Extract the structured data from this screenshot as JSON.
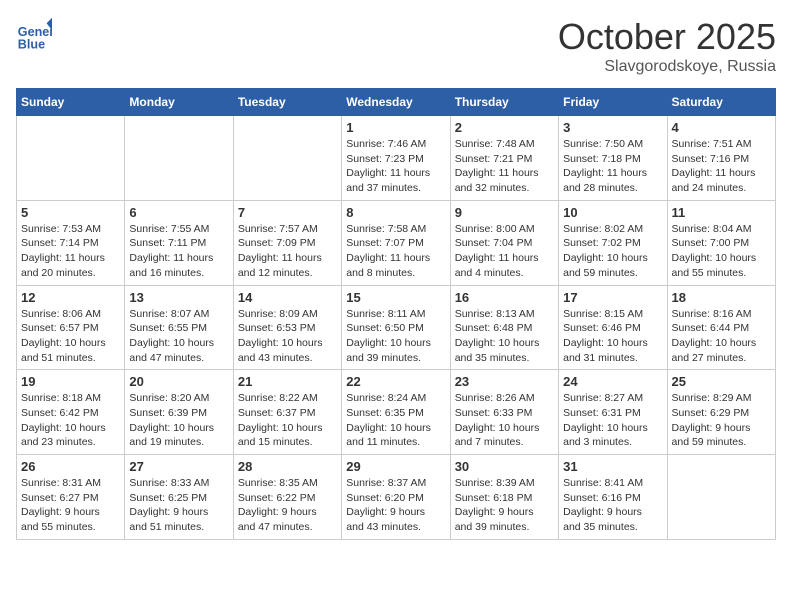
{
  "header": {
    "logo_line1": "General",
    "logo_line2": "Blue",
    "month": "October 2025",
    "location": "Slavgorodskoye, Russia"
  },
  "days_of_week": [
    "Sunday",
    "Monday",
    "Tuesday",
    "Wednesday",
    "Thursday",
    "Friday",
    "Saturday"
  ],
  "weeks": [
    [
      {
        "day": "",
        "info": ""
      },
      {
        "day": "",
        "info": ""
      },
      {
        "day": "",
        "info": ""
      },
      {
        "day": "1",
        "info": "Sunrise: 7:46 AM\nSunset: 7:23 PM\nDaylight: 11 hours\nand 37 minutes."
      },
      {
        "day": "2",
        "info": "Sunrise: 7:48 AM\nSunset: 7:21 PM\nDaylight: 11 hours\nand 32 minutes."
      },
      {
        "day": "3",
        "info": "Sunrise: 7:50 AM\nSunset: 7:18 PM\nDaylight: 11 hours\nand 28 minutes."
      },
      {
        "day": "4",
        "info": "Sunrise: 7:51 AM\nSunset: 7:16 PM\nDaylight: 11 hours\nand 24 minutes."
      }
    ],
    [
      {
        "day": "5",
        "info": "Sunrise: 7:53 AM\nSunset: 7:14 PM\nDaylight: 11 hours\nand 20 minutes."
      },
      {
        "day": "6",
        "info": "Sunrise: 7:55 AM\nSunset: 7:11 PM\nDaylight: 11 hours\nand 16 minutes."
      },
      {
        "day": "7",
        "info": "Sunrise: 7:57 AM\nSunset: 7:09 PM\nDaylight: 11 hours\nand 12 minutes."
      },
      {
        "day": "8",
        "info": "Sunrise: 7:58 AM\nSunset: 7:07 PM\nDaylight: 11 hours\nand 8 minutes."
      },
      {
        "day": "9",
        "info": "Sunrise: 8:00 AM\nSunset: 7:04 PM\nDaylight: 11 hours\nand 4 minutes."
      },
      {
        "day": "10",
        "info": "Sunrise: 8:02 AM\nSunset: 7:02 PM\nDaylight: 10 hours\nand 59 minutes."
      },
      {
        "day": "11",
        "info": "Sunrise: 8:04 AM\nSunset: 7:00 PM\nDaylight: 10 hours\nand 55 minutes."
      }
    ],
    [
      {
        "day": "12",
        "info": "Sunrise: 8:06 AM\nSunset: 6:57 PM\nDaylight: 10 hours\nand 51 minutes."
      },
      {
        "day": "13",
        "info": "Sunrise: 8:07 AM\nSunset: 6:55 PM\nDaylight: 10 hours\nand 47 minutes."
      },
      {
        "day": "14",
        "info": "Sunrise: 8:09 AM\nSunset: 6:53 PM\nDaylight: 10 hours\nand 43 minutes."
      },
      {
        "day": "15",
        "info": "Sunrise: 8:11 AM\nSunset: 6:50 PM\nDaylight: 10 hours\nand 39 minutes."
      },
      {
        "day": "16",
        "info": "Sunrise: 8:13 AM\nSunset: 6:48 PM\nDaylight: 10 hours\nand 35 minutes."
      },
      {
        "day": "17",
        "info": "Sunrise: 8:15 AM\nSunset: 6:46 PM\nDaylight: 10 hours\nand 31 minutes."
      },
      {
        "day": "18",
        "info": "Sunrise: 8:16 AM\nSunset: 6:44 PM\nDaylight: 10 hours\nand 27 minutes."
      }
    ],
    [
      {
        "day": "19",
        "info": "Sunrise: 8:18 AM\nSunset: 6:42 PM\nDaylight: 10 hours\nand 23 minutes."
      },
      {
        "day": "20",
        "info": "Sunrise: 8:20 AM\nSunset: 6:39 PM\nDaylight: 10 hours\nand 19 minutes."
      },
      {
        "day": "21",
        "info": "Sunrise: 8:22 AM\nSunset: 6:37 PM\nDaylight: 10 hours\nand 15 minutes."
      },
      {
        "day": "22",
        "info": "Sunrise: 8:24 AM\nSunset: 6:35 PM\nDaylight: 10 hours\nand 11 minutes."
      },
      {
        "day": "23",
        "info": "Sunrise: 8:26 AM\nSunset: 6:33 PM\nDaylight: 10 hours\nand 7 minutes."
      },
      {
        "day": "24",
        "info": "Sunrise: 8:27 AM\nSunset: 6:31 PM\nDaylight: 10 hours\nand 3 minutes."
      },
      {
        "day": "25",
        "info": "Sunrise: 8:29 AM\nSunset: 6:29 PM\nDaylight: 9 hours\nand 59 minutes."
      }
    ],
    [
      {
        "day": "26",
        "info": "Sunrise: 8:31 AM\nSunset: 6:27 PM\nDaylight: 9 hours\nand 55 minutes."
      },
      {
        "day": "27",
        "info": "Sunrise: 8:33 AM\nSunset: 6:25 PM\nDaylight: 9 hours\nand 51 minutes."
      },
      {
        "day": "28",
        "info": "Sunrise: 8:35 AM\nSunset: 6:22 PM\nDaylight: 9 hours\nand 47 minutes."
      },
      {
        "day": "29",
        "info": "Sunrise: 8:37 AM\nSunset: 6:20 PM\nDaylight: 9 hours\nand 43 minutes."
      },
      {
        "day": "30",
        "info": "Sunrise: 8:39 AM\nSunset: 6:18 PM\nDaylight: 9 hours\nand 39 minutes."
      },
      {
        "day": "31",
        "info": "Sunrise: 8:41 AM\nSunset: 6:16 PM\nDaylight: 9 hours\nand 35 minutes."
      },
      {
        "day": "",
        "info": ""
      }
    ]
  ]
}
